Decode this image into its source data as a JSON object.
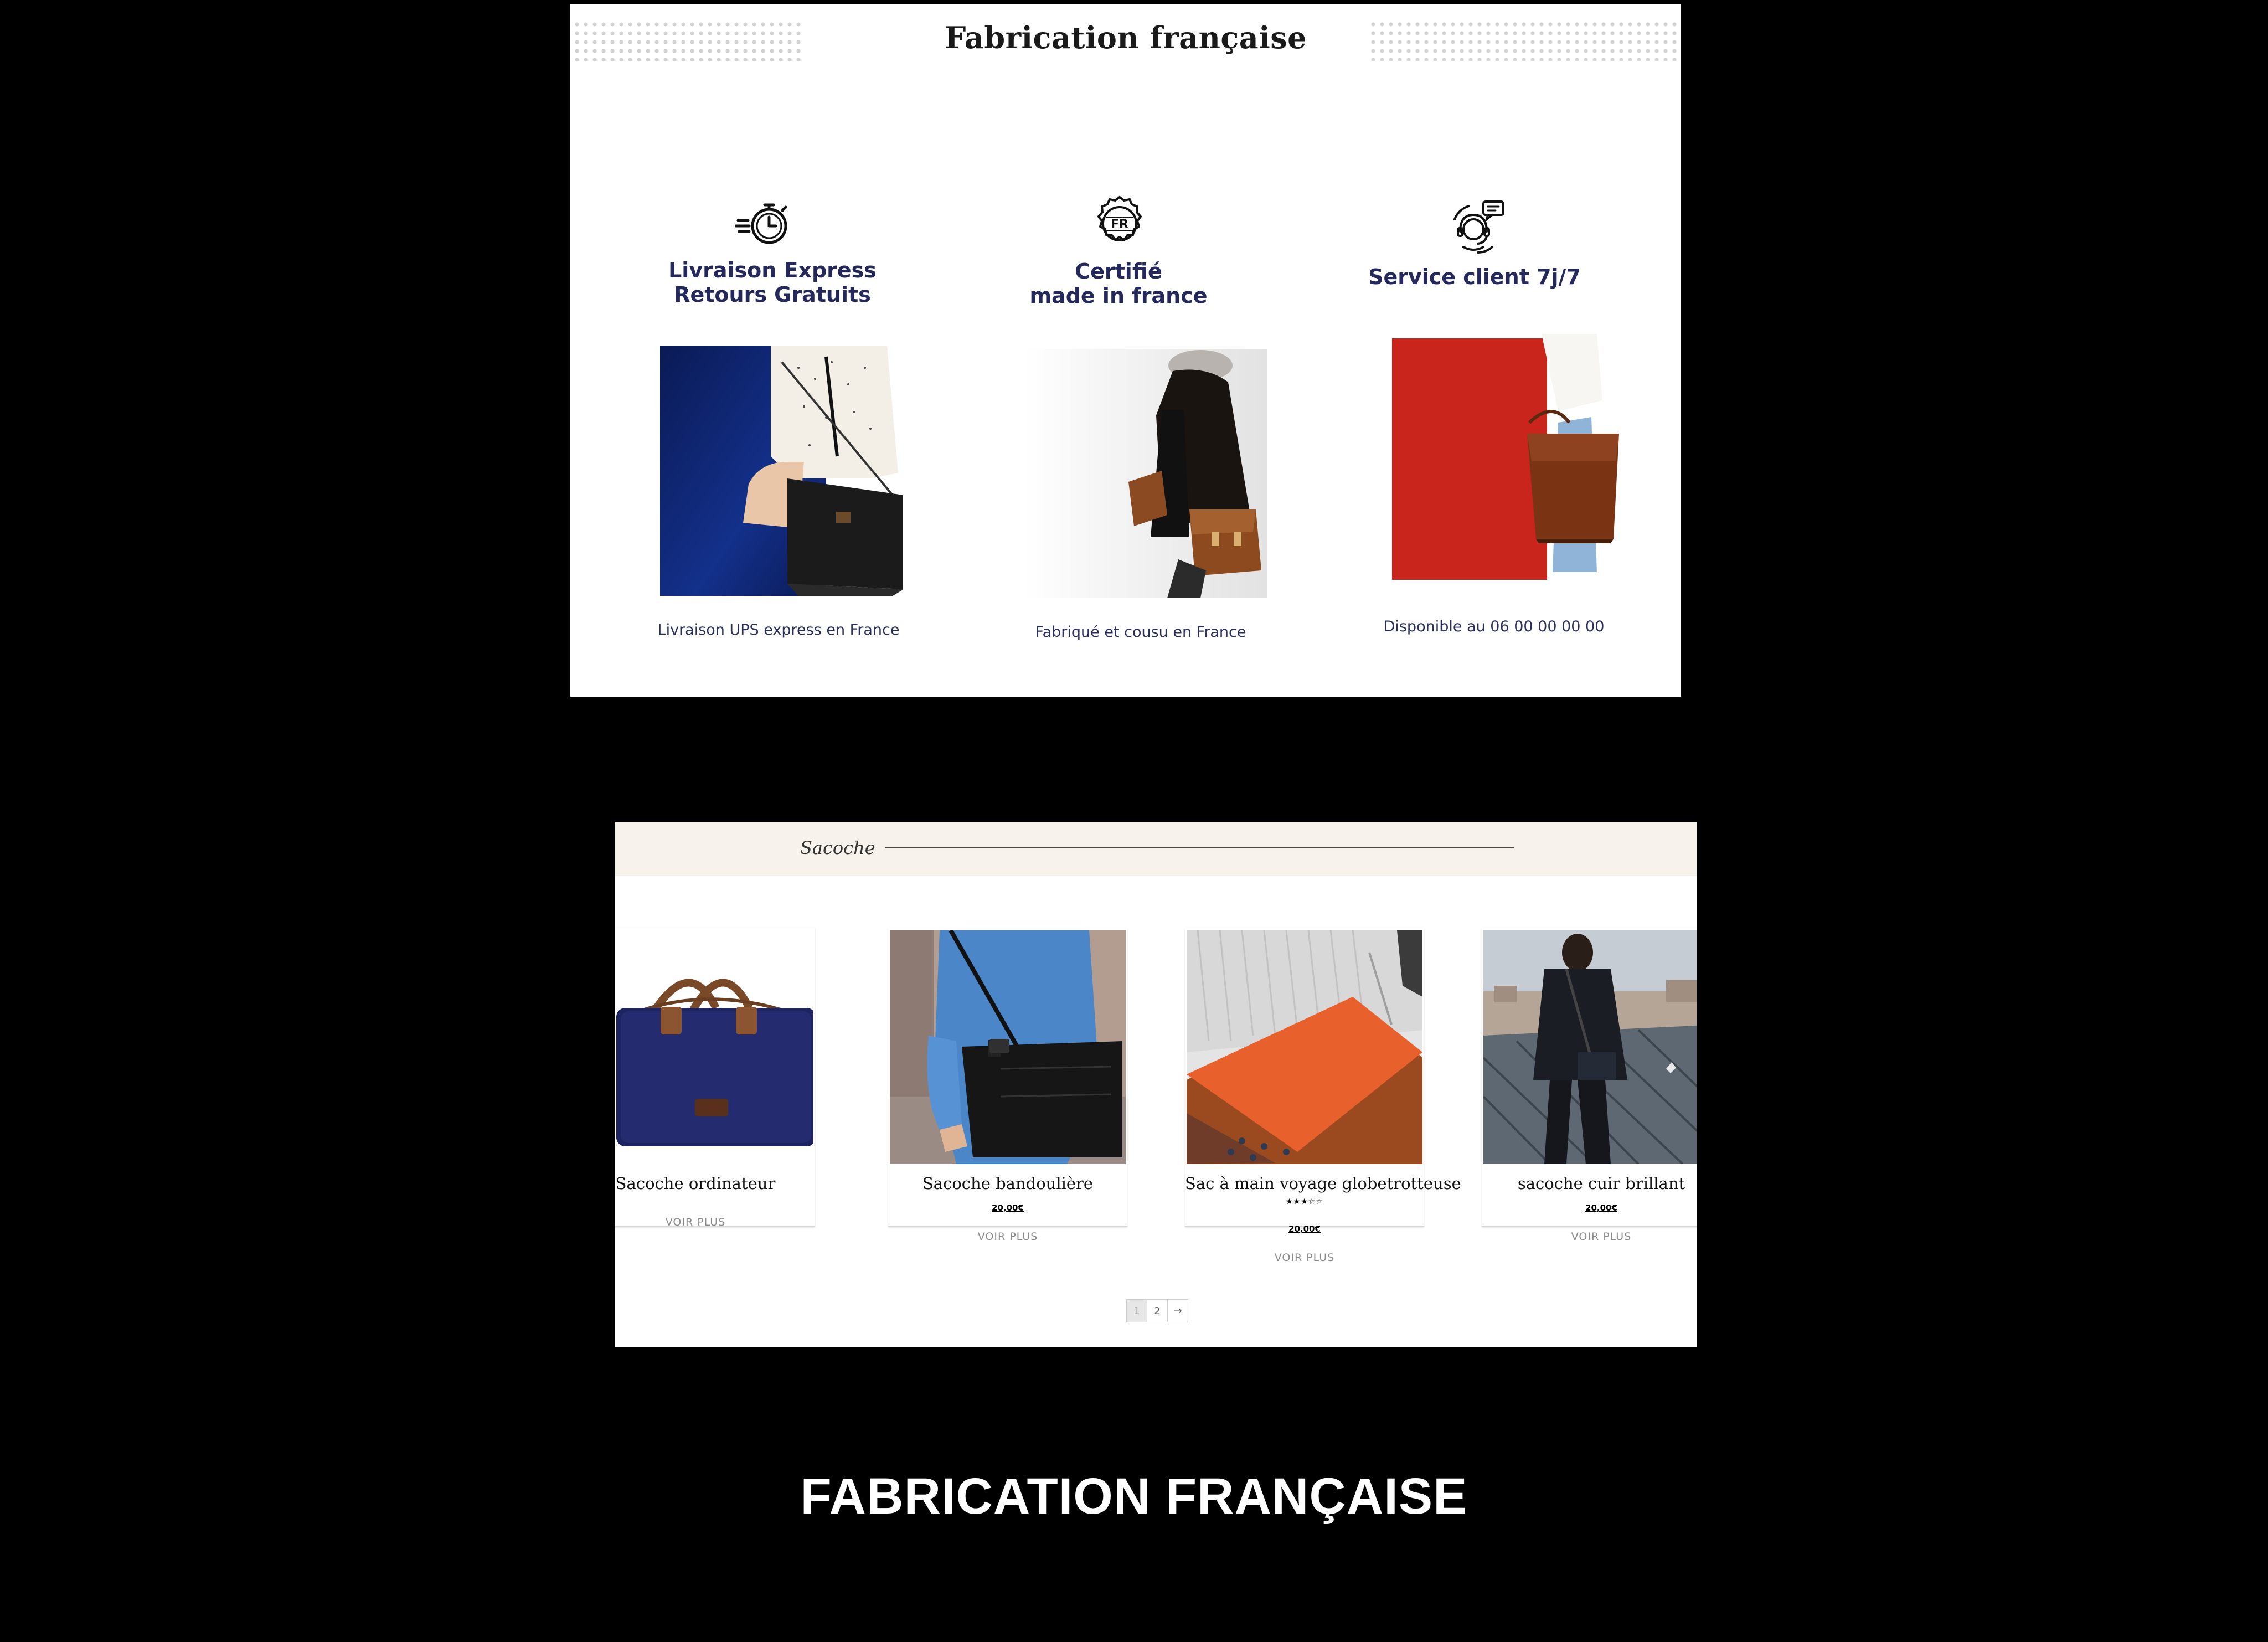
{
  "features_section": {
    "title": "Fabrication française",
    "items": [
      {
        "icon": "stopwatch-icon",
        "heading": "Livraison Express\nRetours Gratuits",
        "caption": "Livraison UPS express en France"
      },
      {
        "icon": "fr-seal-icon",
        "heading": "Certifié\nmade in france",
        "caption": "Fabriqué et cousu en France"
      },
      {
        "icon": "customer-service-icon",
        "heading": "Service client 7j/7",
        "caption": "Disponible au 06 00 00 00 00"
      }
    ],
    "icon_label": "FR"
  },
  "products_section": {
    "category": "Sacoche",
    "products": [
      {
        "name": "Sacoche ordinateur",
        "button": "VOIR PLUS"
      },
      {
        "name": "Sacoche bandoulière",
        "price": "20,00€",
        "button": "VOIR PLUS"
      },
      {
        "name": "Sac à main voyage globetrotteuse",
        "rating": 3,
        "rating_max": 5,
        "price": "20,00€",
        "button": "VOIR PLUS"
      },
      {
        "name": "sacoche cuir brillant",
        "price": "20,00€",
        "button": "VOIR PLUS"
      }
    ],
    "pagination": {
      "pages": [
        "1",
        "2"
      ],
      "current": "1",
      "next": "→"
    }
  },
  "footer_title": "FABRICATION FRANÇAISE",
  "colors": {
    "background": "#000000",
    "feature_text": "#24285a",
    "category_bar": "#f7f2ec"
  }
}
